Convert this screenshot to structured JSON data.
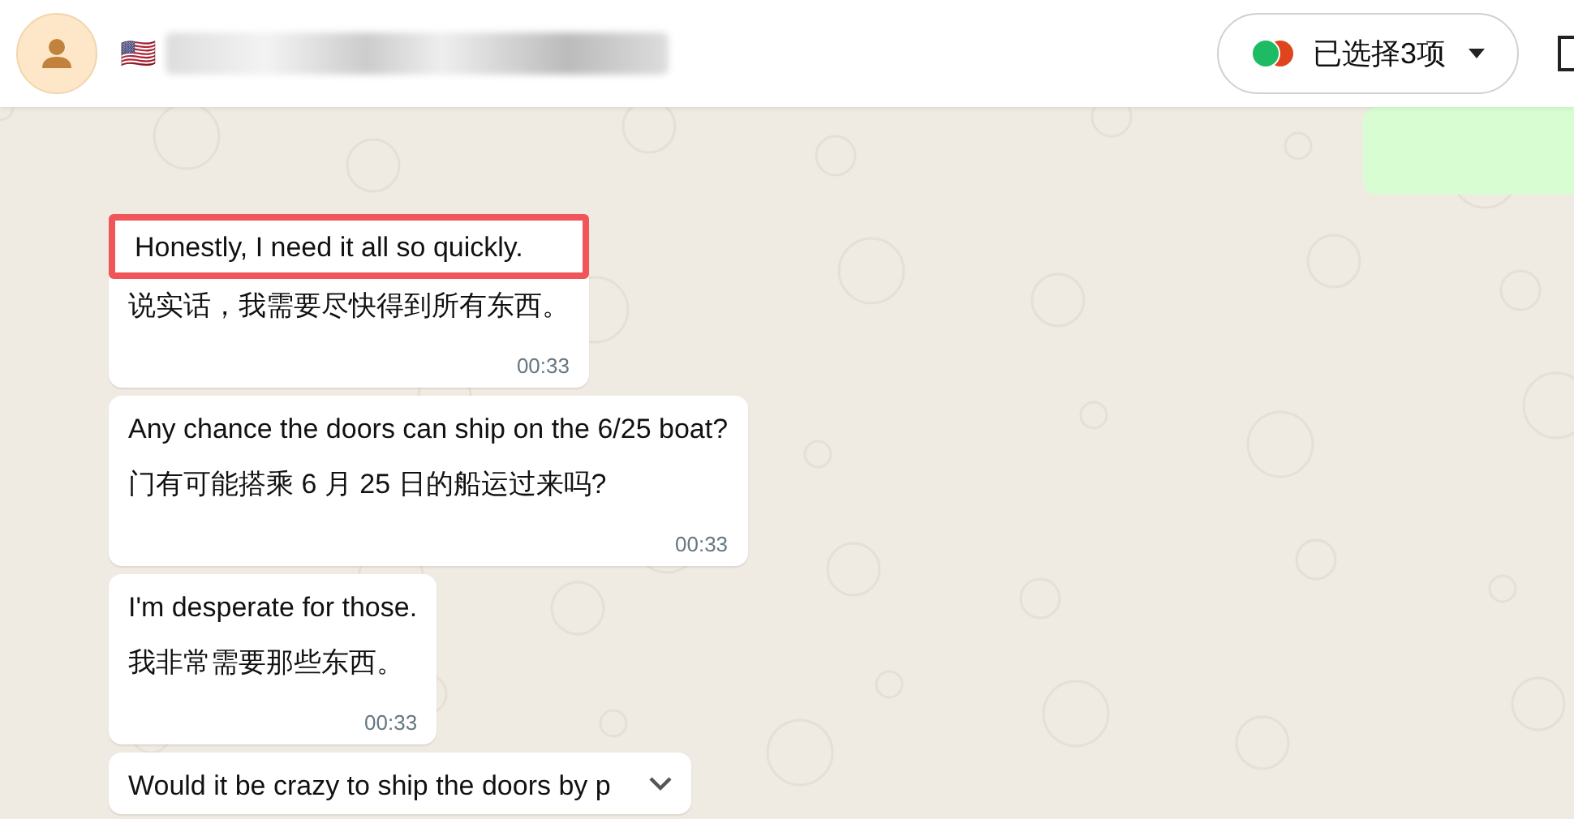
{
  "header": {
    "flag": "🇺🇸",
    "filter": {
      "label": "已选择3项"
    }
  },
  "messages": [
    {
      "original": "Honestly, I need it all so quickly.",
      "translation": "说实话，我需要尽快得到所有东西。",
      "time": "00:33",
      "highlighted": true
    },
    {
      "original": "Any chance the doors can ship on the 6/25 boat?",
      "translation": "门有可能搭乘 6 月 25 日的船运过来吗?",
      "time": "00:33",
      "highlighted": false
    },
    {
      "original": "I'm desperate for those.",
      "translation": "我非常需要那些东西。",
      "time": "00:33",
      "highlighted": false
    },
    {
      "original": "Would it be crazy to ship the doors by p",
      "highlighted": false
    }
  ]
}
